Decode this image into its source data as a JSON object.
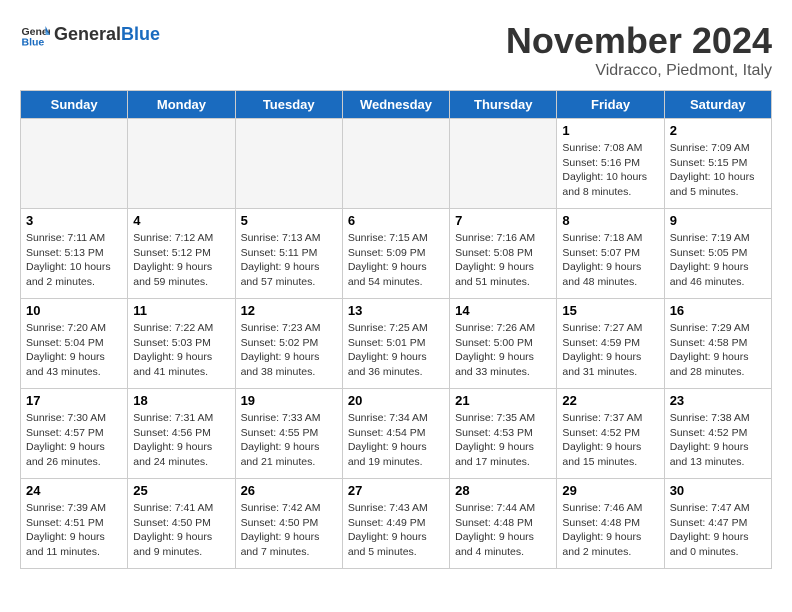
{
  "header": {
    "logo_general": "General",
    "logo_blue": "Blue",
    "month_title": "November 2024",
    "location": "Vidracco, Piedmont, Italy"
  },
  "weekdays": [
    "Sunday",
    "Monday",
    "Tuesday",
    "Wednesday",
    "Thursday",
    "Friday",
    "Saturday"
  ],
  "weeks": [
    [
      {
        "day": "",
        "info": ""
      },
      {
        "day": "",
        "info": ""
      },
      {
        "day": "",
        "info": ""
      },
      {
        "day": "",
        "info": ""
      },
      {
        "day": "",
        "info": ""
      },
      {
        "day": "1",
        "info": "Sunrise: 7:08 AM\nSunset: 5:16 PM\nDaylight: 10 hours\nand 8 minutes."
      },
      {
        "day": "2",
        "info": "Sunrise: 7:09 AM\nSunset: 5:15 PM\nDaylight: 10 hours\nand 5 minutes."
      }
    ],
    [
      {
        "day": "3",
        "info": "Sunrise: 7:11 AM\nSunset: 5:13 PM\nDaylight: 10 hours\nand 2 minutes."
      },
      {
        "day": "4",
        "info": "Sunrise: 7:12 AM\nSunset: 5:12 PM\nDaylight: 9 hours\nand 59 minutes."
      },
      {
        "day": "5",
        "info": "Sunrise: 7:13 AM\nSunset: 5:11 PM\nDaylight: 9 hours\nand 57 minutes."
      },
      {
        "day": "6",
        "info": "Sunrise: 7:15 AM\nSunset: 5:09 PM\nDaylight: 9 hours\nand 54 minutes."
      },
      {
        "day": "7",
        "info": "Sunrise: 7:16 AM\nSunset: 5:08 PM\nDaylight: 9 hours\nand 51 minutes."
      },
      {
        "day": "8",
        "info": "Sunrise: 7:18 AM\nSunset: 5:07 PM\nDaylight: 9 hours\nand 48 minutes."
      },
      {
        "day": "9",
        "info": "Sunrise: 7:19 AM\nSunset: 5:05 PM\nDaylight: 9 hours\nand 46 minutes."
      }
    ],
    [
      {
        "day": "10",
        "info": "Sunrise: 7:20 AM\nSunset: 5:04 PM\nDaylight: 9 hours\nand 43 minutes."
      },
      {
        "day": "11",
        "info": "Sunrise: 7:22 AM\nSunset: 5:03 PM\nDaylight: 9 hours\nand 41 minutes."
      },
      {
        "day": "12",
        "info": "Sunrise: 7:23 AM\nSunset: 5:02 PM\nDaylight: 9 hours\nand 38 minutes."
      },
      {
        "day": "13",
        "info": "Sunrise: 7:25 AM\nSunset: 5:01 PM\nDaylight: 9 hours\nand 36 minutes."
      },
      {
        "day": "14",
        "info": "Sunrise: 7:26 AM\nSunset: 5:00 PM\nDaylight: 9 hours\nand 33 minutes."
      },
      {
        "day": "15",
        "info": "Sunrise: 7:27 AM\nSunset: 4:59 PM\nDaylight: 9 hours\nand 31 minutes."
      },
      {
        "day": "16",
        "info": "Sunrise: 7:29 AM\nSunset: 4:58 PM\nDaylight: 9 hours\nand 28 minutes."
      }
    ],
    [
      {
        "day": "17",
        "info": "Sunrise: 7:30 AM\nSunset: 4:57 PM\nDaylight: 9 hours\nand 26 minutes."
      },
      {
        "day": "18",
        "info": "Sunrise: 7:31 AM\nSunset: 4:56 PM\nDaylight: 9 hours\nand 24 minutes."
      },
      {
        "day": "19",
        "info": "Sunrise: 7:33 AM\nSunset: 4:55 PM\nDaylight: 9 hours\nand 21 minutes."
      },
      {
        "day": "20",
        "info": "Sunrise: 7:34 AM\nSunset: 4:54 PM\nDaylight: 9 hours\nand 19 minutes."
      },
      {
        "day": "21",
        "info": "Sunrise: 7:35 AM\nSunset: 4:53 PM\nDaylight: 9 hours\nand 17 minutes."
      },
      {
        "day": "22",
        "info": "Sunrise: 7:37 AM\nSunset: 4:52 PM\nDaylight: 9 hours\nand 15 minutes."
      },
      {
        "day": "23",
        "info": "Sunrise: 7:38 AM\nSunset: 4:52 PM\nDaylight: 9 hours\nand 13 minutes."
      }
    ],
    [
      {
        "day": "24",
        "info": "Sunrise: 7:39 AM\nSunset: 4:51 PM\nDaylight: 9 hours\nand 11 minutes."
      },
      {
        "day": "25",
        "info": "Sunrise: 7:41 AM\nSunset: 4:50 PM\nDaylight: 9 hours\nand 9 minutes."
      },
      {
        "day": "26",
        "info": "Sunrise: 7:42 AM\nSunset: 4:50 PM\nDaylight: 9 hours\nand 7 minutes."
      },
      {
        "day": "27",
        "info": "Sunrise: 7:43 AM\nSunset: 4:49 PM\nDaylight: 9 hours\nand 5 minutes."
      },
      {
        "day": "28",
        "info": "Sunrise: 7:44 AM\nSunset: 4:48 PM\nDaylight: 9 hours\nand 4 minutes."
      },
      {
        "day": "29",
        "info": "Sunrise: 7:46 AM\nSunset: 4:48 PM\nDaylight: 9 hours\nand 2 minutes."
      },
      {
        "day": "30",
        "info": "Sunrise: 7:47 AM\nSunset: 4:47 PM\nDaylight: 9 hours\nand 0 minutes."
      }
    ]
  ]
}
